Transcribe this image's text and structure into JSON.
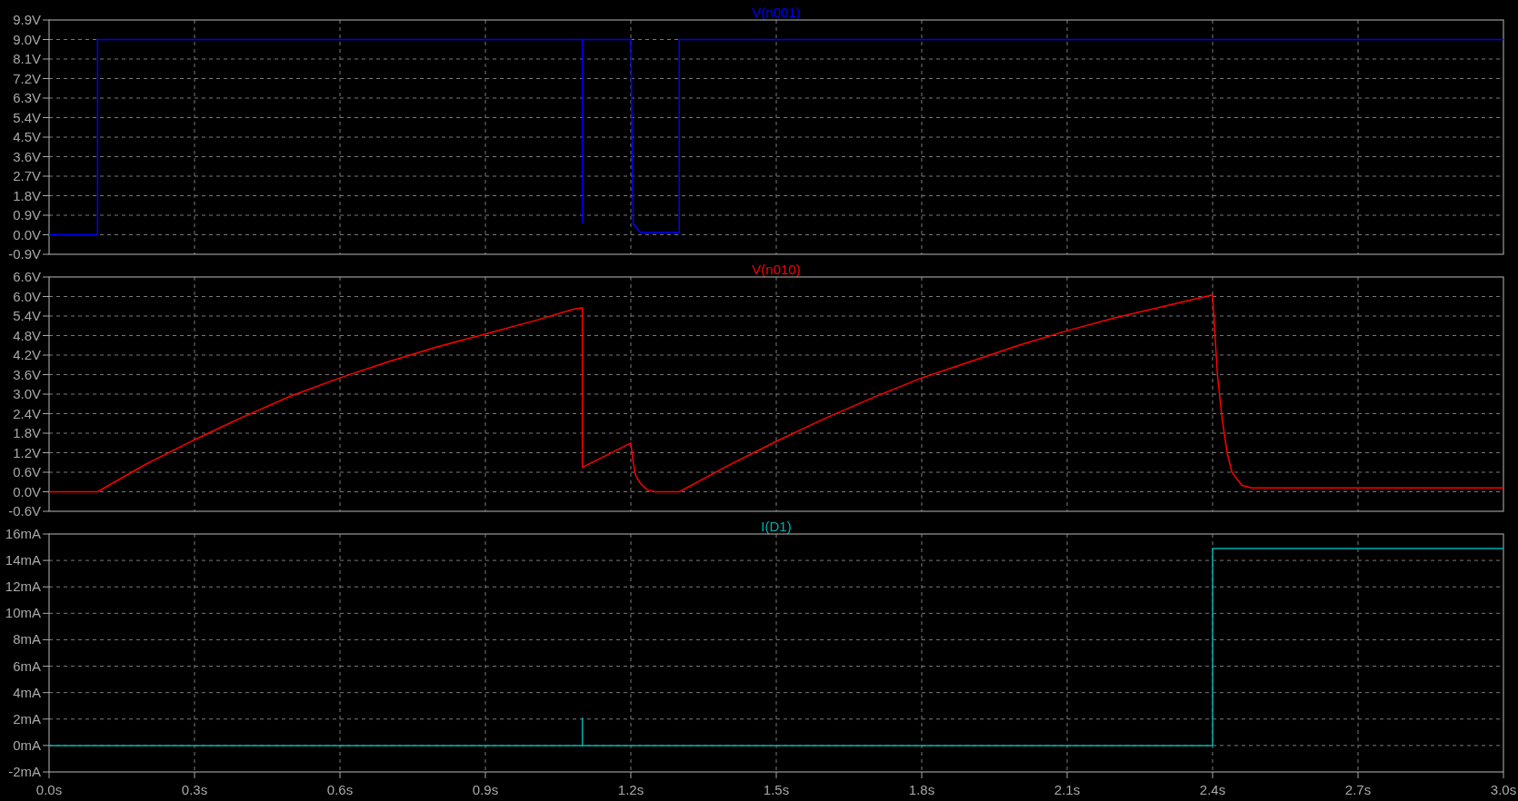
{
  "panes": [
    {
      "chart_data": {
        "type": "line",
        "x": [
          0,
          0.1,
          0.1,
          1.1,
          1.1,
          1.1,
          1.2,
          1.205,
          1.22,
          1.3,
          1.3,
          2.4,
          3.0
        ],
        "series": [
          {
            "name": "V(n001)",
            "color": "#0000ff",
            "values": [
              0,
              0,
              9,
              9,
              0.5,
              9,
              9,
              0.5,
              0.1,
              0.1,
              9,
              9,
              9
            ]
          }
        ],
        "xlim": [
          0,
          3
        ],
        "ylim": [
          -0.9,
          9.9
        ],
        "grid": true,
        "yticks": [
          {
            "value": 9.9,
            "label": "9.9V"
          },
          {
            "value": 9.0,
            "label": "9.0V"
          },
          {
            "value": 8.1,
            "label": "8.1V"
          },
          {
            "value": 7.2,
            "label": "7.2V"
          },
          {
            "value": 6.3,
            "label": "6.3V"
          },
          {
            "value": 5.4,
            "label": "5.4V"
          },
          {
            "value": 4.5,
            "label": "4.5V"
          },
          {
            "value": 3.6,
            "label": "3.6V"
          },
          {
            "value": 2.7,
            "label": "2.7V"
          },
          {
            "value": 1.8,
            "label": "1.8V"
          },
          {
            "value": 0.9,
            "label": "0.9V"
          },
          {
            "value": 0,
            "label": "0.0V"
          },
          {
            "value": -0.9,
            "label": "-0.9V"
          }
        ]
      }
    },
    {
      "chart_data": {
        "type": "line",
        "x": [
          0,
          0.1,
          0.2,
          0.3,
          0.4,
          0.5,
          0.6,
          0.7,
          0.8,
          0.9,
          1.0,
          1.08,
          1.1,
          1.1,
          1.2,
          1.205,
          1.21,
          1.22,
          1.235,
          1.25,
          1.3,
          1.4,
          1.5,
          1.6,
          1.7,
          1.8,
          1.9,
          2.0,
          2.1,
          2.2,
          2.3,
          2.4,
          2.4,
          2.405,
          2.41,
          2.42,
          2.43,
          2.44,
          2.46,
          2.48,
          3.0
        ],
        "series": [
          {
            "name": "V(n010)",
            "color": "#ff0000",
            "values": [
              0,
              0,
              0.85,
              1.6,
              2.3,
              2.95,
              3.5,
              4.0,
              4.45,
              4.85,
              5.25,
              5.6,
              5.65,
              0.75,
              1.5,
              0.9,
              0.5,
              0.25,
              0.05,
              0,
              0,
              0.8,
              1.55,
              2.25,
              2.9,
              3.5,
              4.0,
              4.5,
              4.95,
              5.35,
              5.7,
              6.05,
              6.05,
              4.8,
              3.6,
              2.2,
              1.2,
              0.6,
              0.2,
              0.12,
              0.12
            ]
          }
        ],
        "xlim": [
          0,
          3
        ],
        "ylim": [
          -0.6,
          6.6
        ],
        "grid": true,
        "yticks": [
          {
            "value": 6.6,
            "label": "6.6V"
          },
          {
            "value": 6.0,
            "label": "6.0V"
          },
          {
            "value": 5.4,
            "label": "5.4V"
          },
          {
            "value": 4.8,
            "label": "4.8V"
          },
          {
            "value": 4.2,
            "label": "4.2V"
          },
          {
            "value": 3.6,
            "label": "3.6V"
          },
          {
            "value": 3.0,
            "label": "3.0V"
          },
          {
            "value": 2.4,
            "label": "2.4V"
          },
          {
            "value": 1.8,
            "label": "1.8V"
          },
          {
            "value": 1.2,
            "label": "1.2V"
          },
          {
            "value": 0.6,
            "label": "0.6V"
          },
          {
            "value": 0,
            "label": "0.0V"
          },
          {
            "value": -0.6,
            "label": "-0.6V"
          }
        ]
      }
    },
    {
      "chart_data": {
        "type": "line",
        "x": [
          0,
          1.1,
          1.1,
          1.1,
          2.4,
          2.4,
          3.0
        ],
        "series": [
          {
            "name": "I(D1)",
            "color": "#00b0b0",
            "values": [
              0,
              0,
              2.1,
              0,
              0,
              14.9,
              14.9
            ]
          }
        ],
        "xlim": [
          0,
          3
        ],
        "ylim": [
          -2,
          16
        ],
        "grid": true,
        "xticks": [
          {
            "value": 0,
            "label": "0.0s"
          },
          {
            "value": 0.3,
            "label": "0.3s"
          },
          {
            "value": 0.6,
            "label": "0.6s"
          },
          {
            "value": 0.9,
            "label": "0.9s"
          },
          {
            "value": 1.2,
            "label": "1.2s"
          },
          {
            "value": 1.5,
            "label": "1.5s"
          },
          {
            "value": 1.8,
            "label": "1.8s"
          },
          {
            "value": 2.1,
            "label": "2.1s"
          },
          {
            "value": 2.4,
            "label": "2.4s"
          },
          {
            "value": 2.7,
            "label": "2.7s"
          },
          {
            "value": 3.0,
            "label": "3.0s"
          }
        ],
        "yticks": [
          {
            "value": 16,
            "label": "16mA"
          },
          {
            "value": 14,
            "label": "14mA"
          },
          {
            "value": 12,
            "label": "12mA"
          },
          {
            "value": 10,
            "label": "10mA"
          },
          {
            "value": 8,
            "label": "8mA"
          },
          {
            "value": 6,
            "label": "6mA"
          },
          {
            "value": 4,
            "label": "4mA"
          },
          {
            "value": 2,
            "label": "2mA"
          },
          {
            "value": 0,
            "label": "0mA"
          },
          {
            "value": -2,
            "label": "-2mA"
          }
        ]
      }
    }
  ]
}
